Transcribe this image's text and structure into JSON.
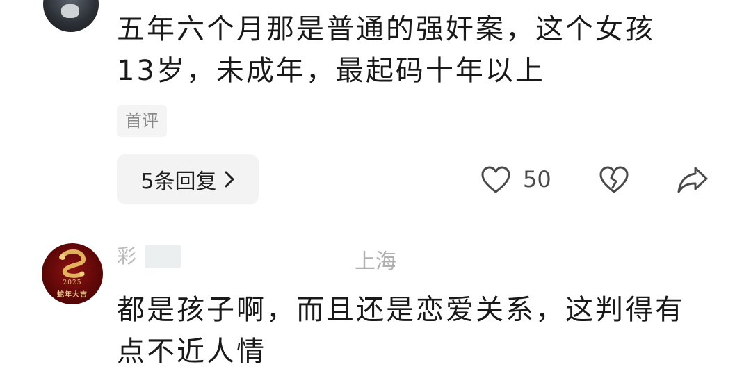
{
  "comments": [
    {
      "text": "五年六个月那是普通的强奸案，这个女孩13岁，未成年，最起码十年以上",
      "badge": "首评",
      "replies_label": "5条回复",
      "like_count": "50"
    },
    {
      "username": "彩",
      "location": "上海",
      "avatar_year": "2025",
      "avatar_text": "蛇年大吉",
      "text": "都是孩子啊，而且还是恋爱关系，这判得有点不近人情"
    }
  ],
  "icons": {
    "like": "heart-outline-icon",
    "dislike": "broken-heart-icon",
    "share": "share-arrow-icon",
    "reply_chevron": "chevron-right-icon"
  },
  "colors": {
    "text": "#191919",
    "muted": "#8a8a8a",
    "chip_bg": "#f3f3f3",
    "icon": "#4a4a4a"
  }
}
